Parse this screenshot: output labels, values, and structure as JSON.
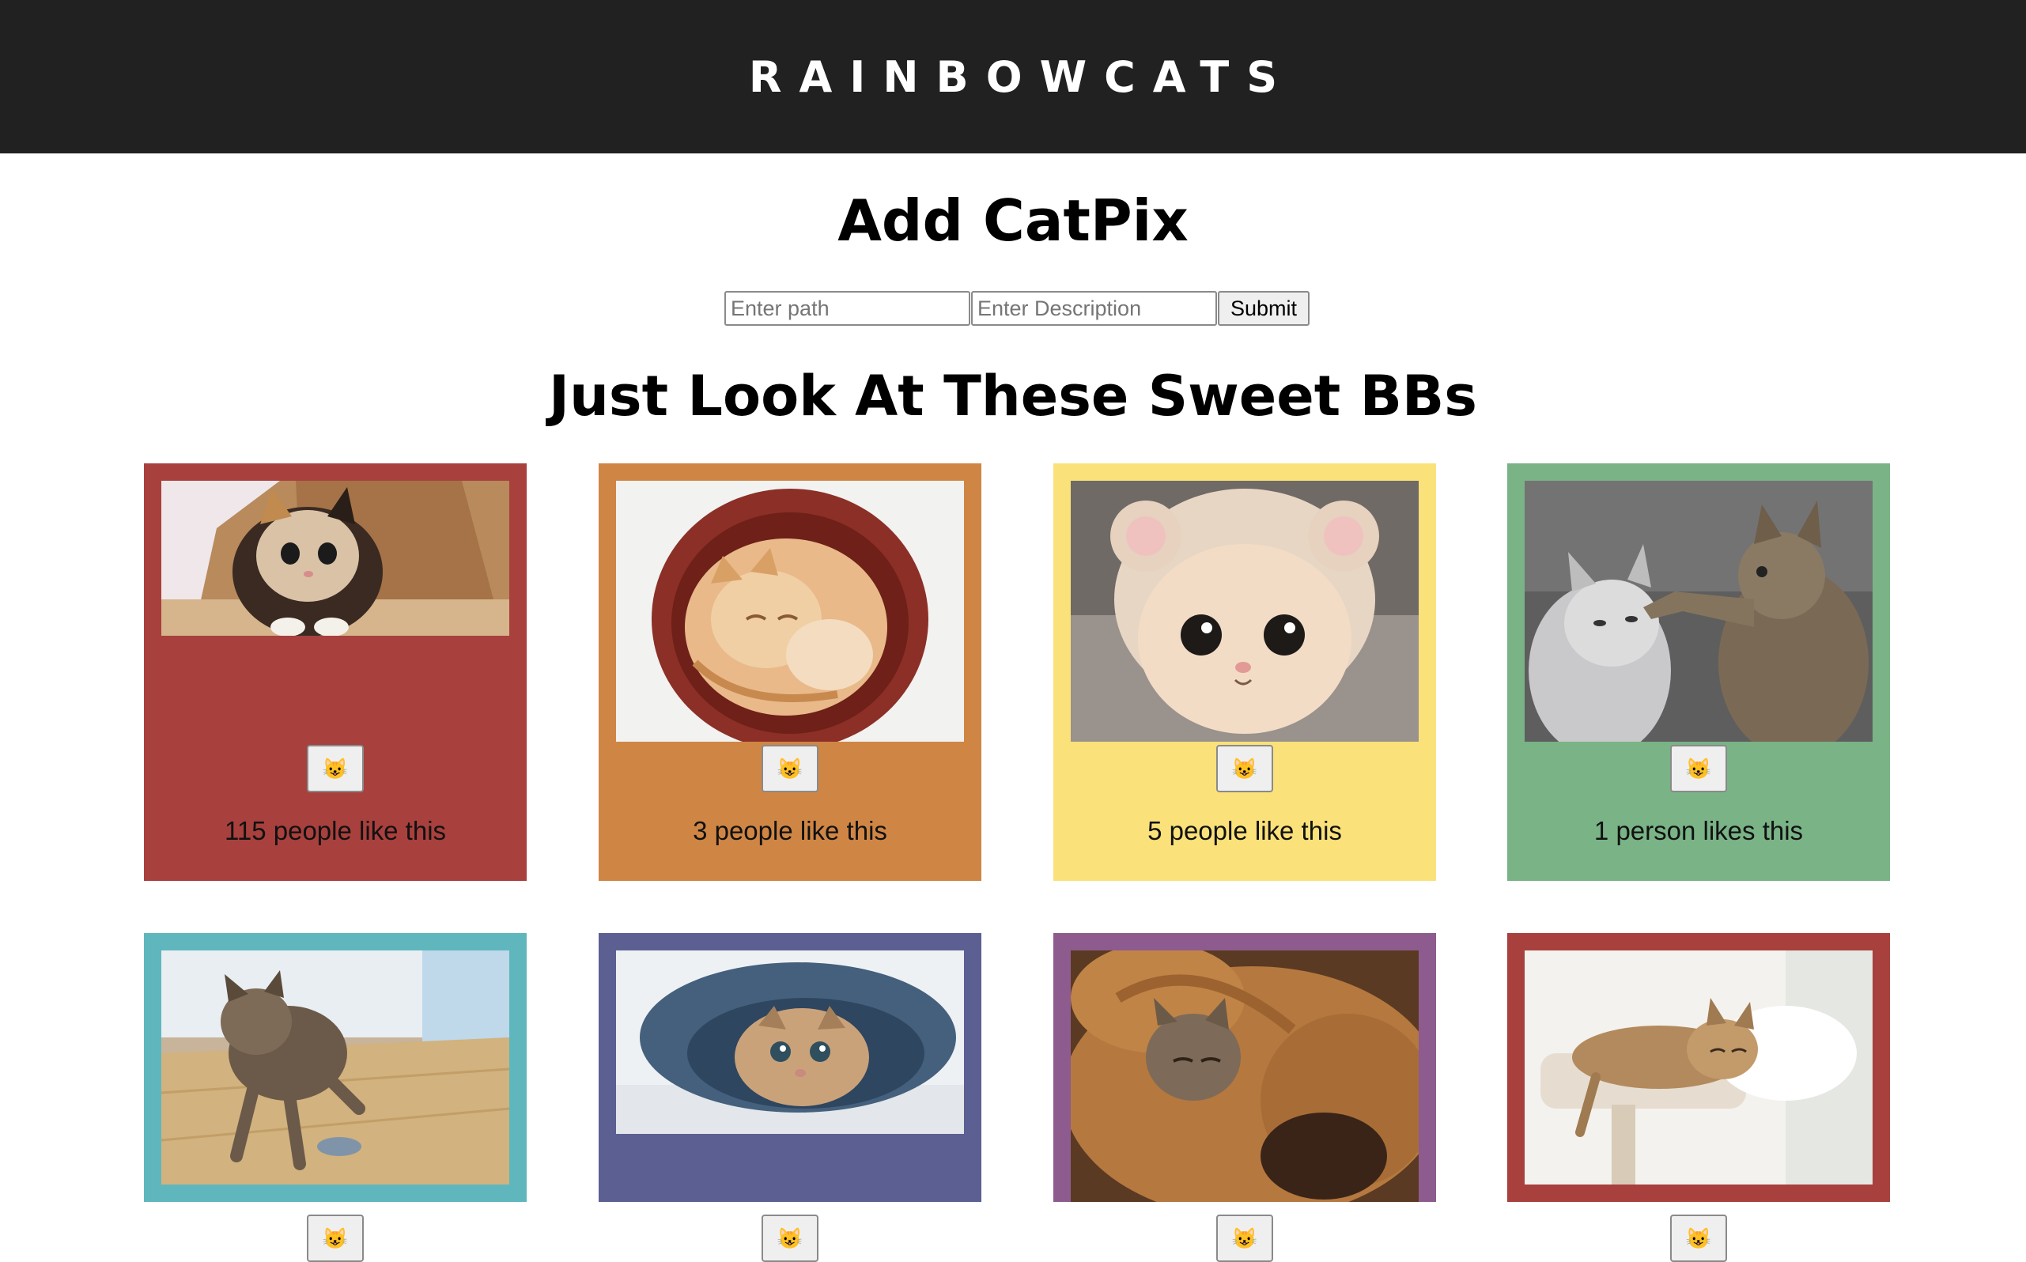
{
  "header": {
    "title": "RAINBOWCATS"
  },
  "add_section": {
    "title": "Add CatPix",
    "path_placeholder": "Enter path",
    "description_placeholder": "Enter Description",
    "submit_label": "Submit"
  },
  "gallery": {
    "title": "Just Look At These Sweet BBs",
    "cards": [
      {
        "color": "#a8403d",
        "like_icon": "😺",
        "likes_text": "115 people like this",
        "image": "kitten-in-paper-bag"
      },
      {
        "color": "#cf8645",
        "like_icon": "😺",
        "likes_text": "3 people like this",
        "image": "kitten-sleeping-in-bowl"
      },
      {
        "color": "#fae17a",
        "like_icon": "😺",
        "likes_text": "5 people like this",
        "image": "cat-in-bear-hat"
      },
      {
        "color": "#79b386",
        "like_icon": "😺",
        "likes_text": "1 person likes this",
        "image": "cat-patting-kitten"
      },
      {
        "color": "#5fb7bd",
        "like_icon": "😺",
        "likes_text": "",
        "image": "kitten-playing-with-toy-mouse"
      },
      {
        "color": "#5c5f92",
        "like_icon": "😺",
        "likes_text": "",
        "image": "kitten-in-jeans"
      },
      {
        "color": "#8d5b8e",
        "like_icon": "😺",
        "likes_text": "",
        "image": "kitten-sleeping-on-dog"
      },
      {
        "color": "#a8403d",
        "like_icon": "😺",
        "likes_text": "",
        "image": "kittens-on-cat-tree"
      }
    ]
  }
}
